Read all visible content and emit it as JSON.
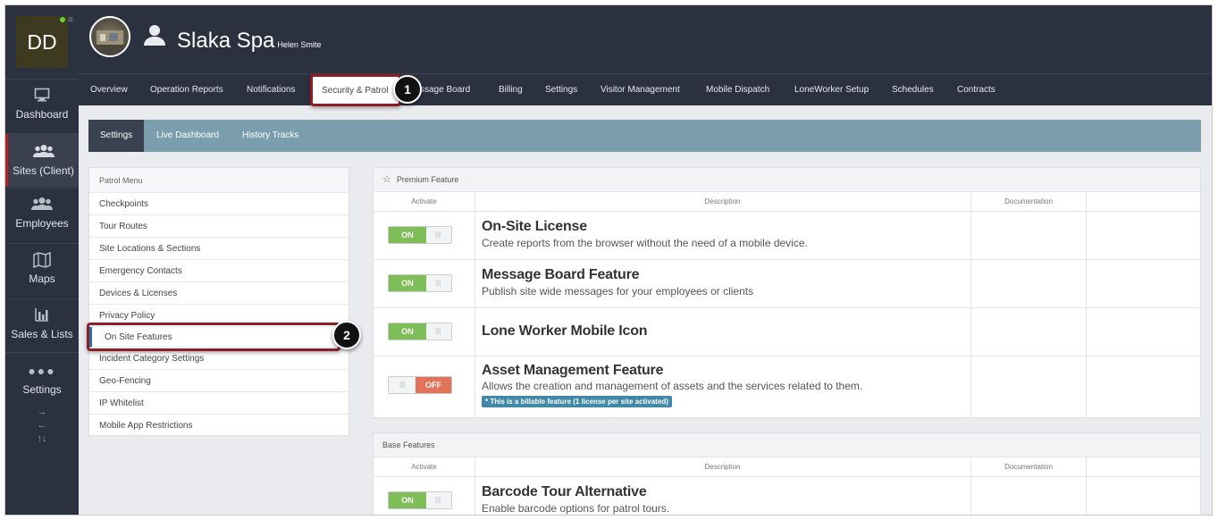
{
  "sidebar": {
    "avatar_initials": "DD",
    "items": [
      {
        "label": "Dashboard",
        "icon": "monitor-icon"
      },
      {
        "label": "Sites (Client)",
        "icon": "group-icon",
        "active": true
      },
      {
        "label": "Employees",
        "icon": "group-icon"
      },
      {
        "label": "Maps",
        "icon": "map-icon"
      },
      {
        "label": "Sales & Lists",
        "icon": "bar-chart-icon"
      },
      {
        "label": "Settings",
        "icon": "more-dots-icon"
      }
    ],
    "arrows": [
      "→",
      "←",
      "↑↓"
    ]
  },
  "header": {
    "title": "Slaka Spa",
    "subtitle": "Helen Smite"
  },
  "topnav": {
    "items": [
      "Overview",
      "Operation Reports",
      "Notifications",
      "Security & Patrol",
      "ssage Board",
      "Billing",
      "Settings",
      "Visitor Management",
      "Mobile Dispatch",
      "LoneWorker Setup",
      "Schedules",
      "Contracts"
    ],
    "active": "Security & Patrol"
  },
  "subnav": {
    "items": [
      "Settings",
      "Live Dashboard",
      "History Tracks"
    ],
    "active": "Settings"
  },
  "patrol_menu": {
    "title": "Patrol Menu",
    "items": [
      "Checkpoints",
      "Tour Routes",
      "Site Locations & Sections",
      "Emergency Contacts",
      "Devices & Licenses",
      "Privacy Policy",
      "On Site Features",
      "Incident Category Settings",
      "Geo-Fencing",
      "IP Whitelist",
      "Mobile App Restrictions"
    ],
    "active": "On Site Features"
  },
  "columns": {
    "activate": "Activate",
    "description": "Description",
    "documentation": "Documentation"
  },
  "premium": {
    "title": "Premium Feature",
    "features": [
      {
        "title": "On-Site License",
        "description": "Create reports from the browser without the need of a mobile device.",
        "state": "ON"
      },
      {
        "title": "Message Board Feature",
        "description": "Publish site wide messages for your employees or clients",
        "state": "ON"
      },
      {
        "title": "Lone Worker Mobile Icon",
        "description": "",
        "state": "ON"
      },
      {
        "title": "Asset Management Feature",
        "description": "Allows the creation and management of assets and the services related to them.",
        "state": "OFF",
        "badge": "* This is a billable feature (1 license per site activated)"
      }
    ]
  },
  "base": {
    "title": "Base Features",
    "features": [
      {
        "title": "Barcode Tour Alternative",
        "description": "Enable barcode options for patrol tours.",
        "state": "ON"
      }
    ]
  },
  "toggle_labels": {
    "on": "ON",
    "off": "OFF"
  },
  "callouts": [
    "1",
    "2"
  ],
  "colors": {
    "sidebar_bg": "#2c3140",
    "accent_red": "#b3202a",
    "subnav_bg": "#7b9eae",
    "toggle_on": "#7fbd58",
    "toggle_off": "#e2735b",
    "badge": "#3f88a7",
    "callout_border": "#8c1d26"
  }
}
